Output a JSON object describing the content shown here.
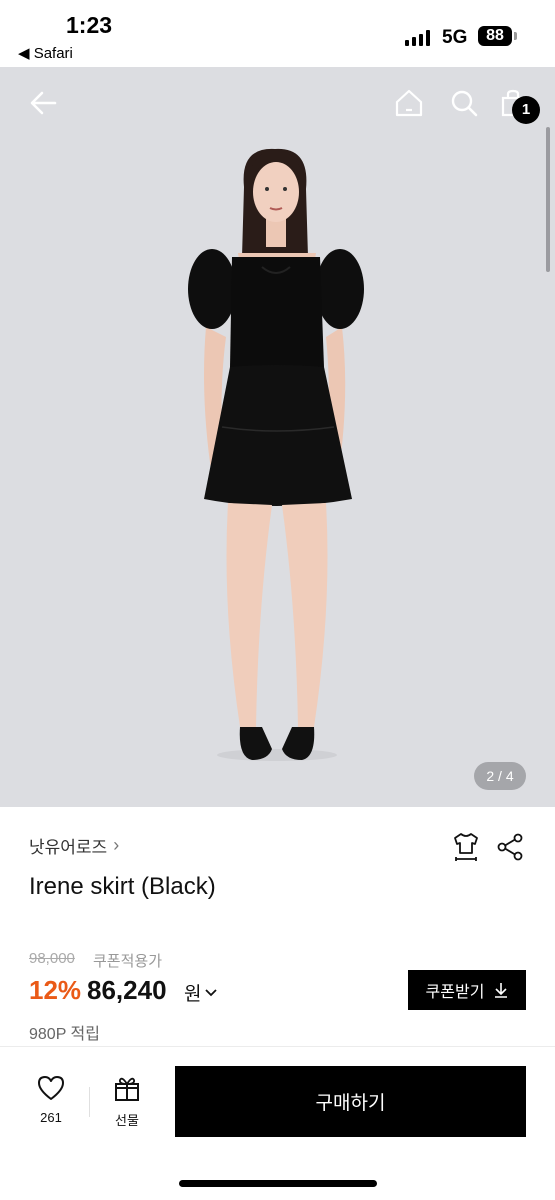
{
  "status_bar": {
    "time": "1:23",
    "back_app": "◀ Safari",
    "network": "5G",
    "battery": "88"
  },
  "nav": {
    "cart_count": "1",
    "icons": [
      "back-arrow-icon",
      "home-icon",
      "search-icon",
      "shopping-bag-icon"
    ]
  },
  "gallery": {
    "indicator": "2 / 4"
  },
  "product": {
    "brand": "낫유어로즈",
    "name": "Irene skirt (Black)",
    "original_price": "98,000",
    "coupon_applied_label": "쿠폰적용가",
    "discount": "12%",
    "price": "86,240",
    "currency": "원",
    "points": "980P 적립"
  },
  "coupon_button": {
    "label": "쿠폰받기"
  },
  "bottom_bar": {
    "likes": "261",
    "gift_label": "선물",
    "buy_label": "구매하기"
  },
  "colors": {
    "discount": "#ea5a17",
    "background_photo": "#dcdde1",
    "primary": "#000000"
  }
}
